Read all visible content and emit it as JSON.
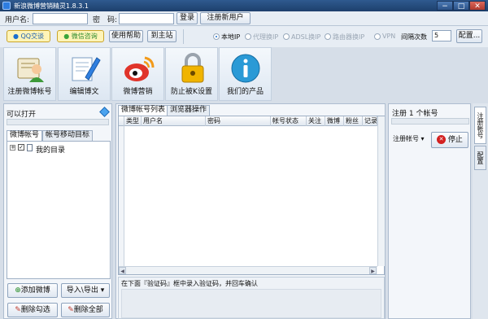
{
  "window": {
    "title": "新浪微博营销精灵1.8.3.1",
    "min": "−",
    "max": "□",
    "close": "✕"
  },
  "login": {
    "username_label": "用户名:",
    "username_value": "",
    "password_label": "密　码:",
    "password_value": "",
    "login_button": "登录",
    "register_button": "注册新用户"
  },
  "toolbar": {
    "qq_button": "QQ交谈",
    "wechat_button": "微信咨询",
    "help_button": "使用帮助",
    "home_button": "到主站",
    "ip_options": [
      {
        "label": "本地IP",
        "selected": true
      },
      {
        "label": "代理换IP",
        "selected": false
      },
      {
        "label": "ADSL换IP",
        "selected": false
      },
      {
        "label": "路由器换IP",
        "selected": false
      },
      {
        "label": "VPN",
        "selected": false
      }
    ],
    "interval_label": "间隔次数",
    "interval_value": "5",
    "config_button": "配置..."
  },
  "tiles": [
    {
      "label": "注册微博帐号",
      "icon": "register-account-icon"
    },
    {
      "label": "编辑博文",
      "icon": "edit-post-icon"
    },
    {
      "label": "微博营销",
      "icon": "weibo-marketing-icon"
    },
    {
      "label": "防止被K设置",
      "icon": "lock-icon"
    },
    {
      "label": "我们的产品",
      "icon": "info-icon"
    }
  ],
  "left_panel": {
    "status_text": "可以打开",
    "tabs": [
      "微博帐号",
      "帐号移动目标"
    ],
    "tree_root": "我的目录",
    "add_button": "添加微博",
    "import_export_button": "导入\\导出",
    "delete_selected_button": "删除勾选",
    "delete_all_button": "删除全部"
  },
  "center_panel": {
    "tabs": [
      "微博帐号列表",
      "浏览器操作"
    ],
    "columns": [
      "类型",
      "用户名",
      "密码",
      "帐号状态",
      "关注",
      "微博",
      "粉丝",
      "记录备"
    ],
    "captcha_hint": "在下面『验证码』框中录入验证码，并回车确认"
  },
  "right_panel": {
    "register_count": "注册 1 个帐号",
    "register_combo": "注册帐号",
    "stop_button": "停止",
    "side_tabs": [
      "注册帐号",
      "配置"
    ]
  },
  "colors": {
    "title_bar": "#1d3f6c",
    "accent": "#1b6fd0",
    "stop_red": "#d32020"
  }
}
